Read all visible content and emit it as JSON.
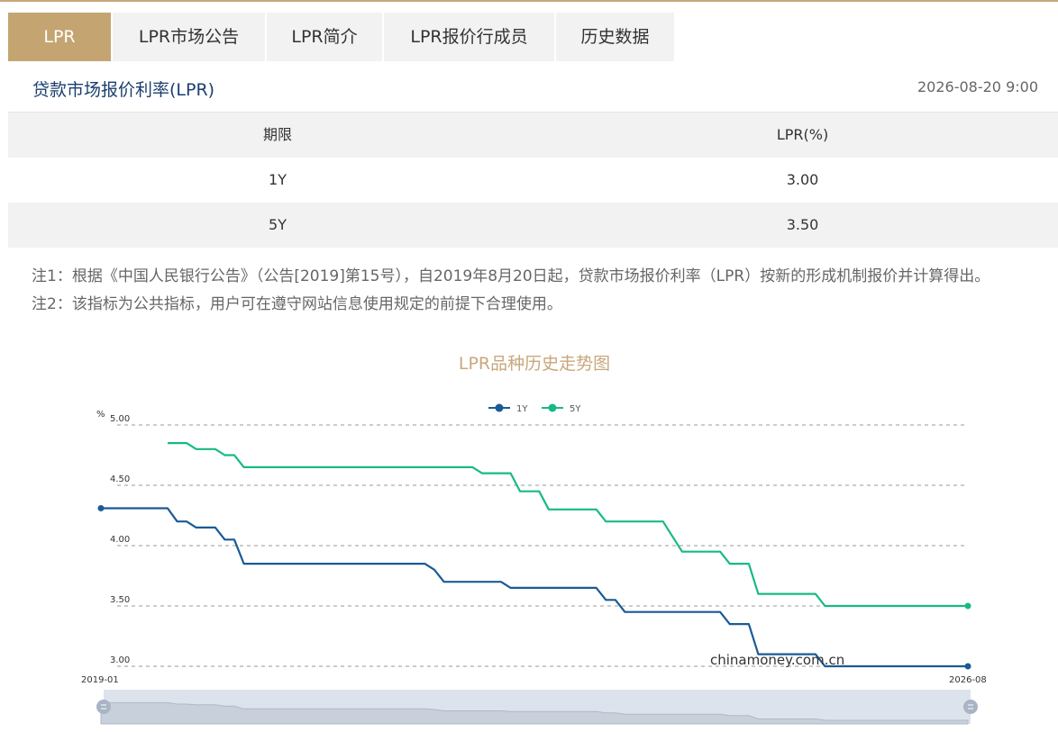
{
  "tabs": [
    {
      "label": "LPR",
      "active": true
    },
    {
      "label": "LPR市场公告",
      "active": false
    },
    {
      "label": "LPR简介",
      "active": false
    },
    {
      "label": "LPR报价行成员",
      "active": false
    },
    {
      "label": "历史数据",
      "active": false
    }
  ],
  "header": {
    "title": "贷款市场报价利率(LPR)",
    "timestamp": "2026-08-20 9:00"
  },
  "table": {
    "headers": [
      "期限",
      "LPR(%)"
    ],
    "rows": [
      {
        "term": "1Y",
        "rate": "3.00"
      },
      {
        "term": "5Y",
        "rate": "3.50"
      }
    ]
  },
  "notes": [
    "注1：根据《中国人民银行公告》（公告[2019]第15号），自2019年8月20日起，贷款市场报价利率（LPR）按新的形成机制报价并计算得出。",
    "注2：该指标为公共指标，用户可在遵守网站信息使用规定的前提下合理使用。"
  ],
  "chart_title": "LPR品种历史走势图",
  "watermark": "chinamoney.com.cn",
  "colors": {
    "accent": "#c4a572",
    "series_1y": "#1a5a96",
    "series_5y": "#18b987"
  },
  "chart_data": {
    "type": "line",
    "title": "LPR品种历史走势图",
    "ylabel": "%",
    "ylim": [
      3.0,
      5.0
    ],
    "yticks": [
      "5.00",
      "4.50",
      "4.00",
      "3.50",
      "3.00"
    ],
    "x_labels": {
      "start": "2019-01",
      "end": "2026-08"
    },
    "legend": {
      "placement": "top-center"
    },
    "grid": true,
    "series": [
      {
        "name": "1Y",
        "points": [
          [
            "2019-01",
            4.31
          ],
          [
            "2019-08",
            4.31
          ],
          [
            "2019-09",
            4.2
          ],
          [
            "2019-10",
            4.2
          ],
          [
            "2019-11",
            4.15
          ],
          [
            "2020-01",
            4.15
          ],
          [
            "2020-02",
            4.05
          ],
          [
            "2020-03",
            4.05
          ],
          [
            "2020-04",
            3.85
          ],
          [
            "2021-11",
            3.85
          ],
          [
            "2021-12",
            3.8
          ],
          [
            "2022-01",
            3.7
          ],
          [
            "2022-07",
            3.7
          ],
          [
            "2022-08",
            3.65
          ],
          [
            "2023-05",
            3.65
          ],
          [
            "2023-06",
            3.55
          ],
          [
            "2023-07",
            3.55
          ],
          [
            "2023-08",
            3.45
          ],
          [
            "2024-06",
            3.45
          ],
          [
            "2024-07",
            3.35
          ],
          [
            "2024-09",
            3.35
          ],
          [
            "2024-10",
            3.1
          ],
          [
            "2025-04",
            3.1
          ],
          [
            "2025-05",
            3.0
          ],
          [
            "2026-08",
            3.0
          ]
        ]
      },
      {
        "name": "5Y",
        "points": [
          [
            "2019-08",
            4.85
          ],
          [
            "2019-10",
            4.85
          ],
          [
            "2019-11",
            4.8
          ],
          [
            "2020-01",
            4.8
          ],
          [
            "2020-02",
            4.75
          ],
          [
            "2020-03",
            4.75
          ],
          [
            "2020-04",
            4.65
          ],
          [
            "2022-04",
            4.65
          ],
          [
            "2022-05",
            4.6
          ],
          [
            "2022-08",
            4.6
          ],
          [
            "2022-09",
            4.45
          ],
          [
            "2022-11",
            4.45
          ],
          [
            "2022-12",
            4.3
          ],
          [
            "2023-05",
            4.3
          ],
          [
            "2023-06",
            4.2
          ],
          [
            "2023-12",
            4.2
          ],
          [
            "2024-02",
            3.95
          ],
          [
            "2024-06",
            3.95
          ],
          [
            "2024-07",
            3.85
          ],
          [
            "2024-09",
            3.85
          ],
          [
            "2024-10",
            3.6
          ],
          [
            "2025-04",
            3.6
          ],
          [
            "2025-05",
            3.5
          ],
          [
            "2026-08",
            3.5
          ]
        ]
      }
    ]
  }
}
